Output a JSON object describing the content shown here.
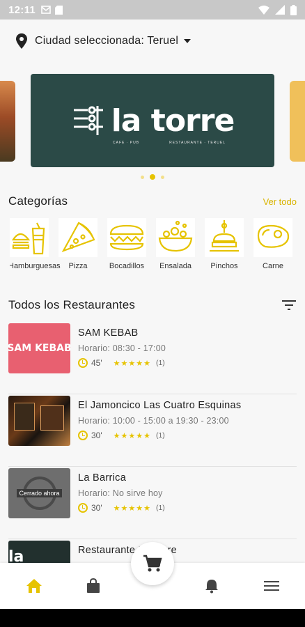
{
  "status_bar": {
    "time": "12:11"
  },
  "city": {
    "label": "Ciudad seleccionada: Teruel"
  },
  "banner": {
    "logo_text": "la torre",
    "logo_sub_left": "CAFE · PUB",
    "logo_sub_right": "RESTAURANTE · TERUEL",
    "active_index": 1,
    "dot_count": 3
  },
  "categories": {
    "title": "Categorías",
    "see_all": "Ver todo",
    "items": [
      {
        "label": "Hamburguesas",
        "icon": "burger-icon"
      },
      {
        "label": "Pizza",
        "icon": "pizza-icon"
      },
      {
        "label": "Bocadillos",
        "icon": "sandwich-icon"
      },
      {
        "label": "Ensalada",
        "icon": "salad-icon"
      },
      {
        "label": "Pinchos",
        "icon": "pincho-icon"
      },
      {
        "label": "Carne",
        "icon": "steak-icon"
      }
    ]
  },
  "restaurants": {
    "title": "Todos los Restaurantes",
    "items": [
      {
        "name": "SAM KEBAB",
        "hours": "Horario: 08:30 - 17:00",
        "time": "45'",
        "rating": "★★★★★",
        "reviews": "(1)",
        "thumb_text": "SAM KEBAB"
      },
      {
        "name": "El Jamoncico Las Cuatro Esquinas",
        "hours": "Horario: 10:00 - 15:00 a 19:30 - 23:00",
        "time": "30'",
        "rating": "★★★★★",
        "reviews": "(1)",
        "thumb_text": ""
      },
      {
        "name": "La Barrica",
        "hours": "Horario: No sirve hoy",
        "time": "30'",
        "rating": "★★★★★",
        "reviews": "(1)",
        "thumb_text": "Cerrado ahora"
      },
      {
        "name": "Restaurante  La Torre",
        "hours": "",
        "time": "",
        "rating": "",
        "reviews": "",
        "thumb_text": "la torre"
      }
    ]
  },
  "colors": {
    "accent": "#E6C300",
    "banner_bg": "#2B4A47"
  },
  "nav": [
    "home-icon",
    "bag-icon",
    "cart-icon",
    "bell-icon",
    "menu-icon"
  ]
}
